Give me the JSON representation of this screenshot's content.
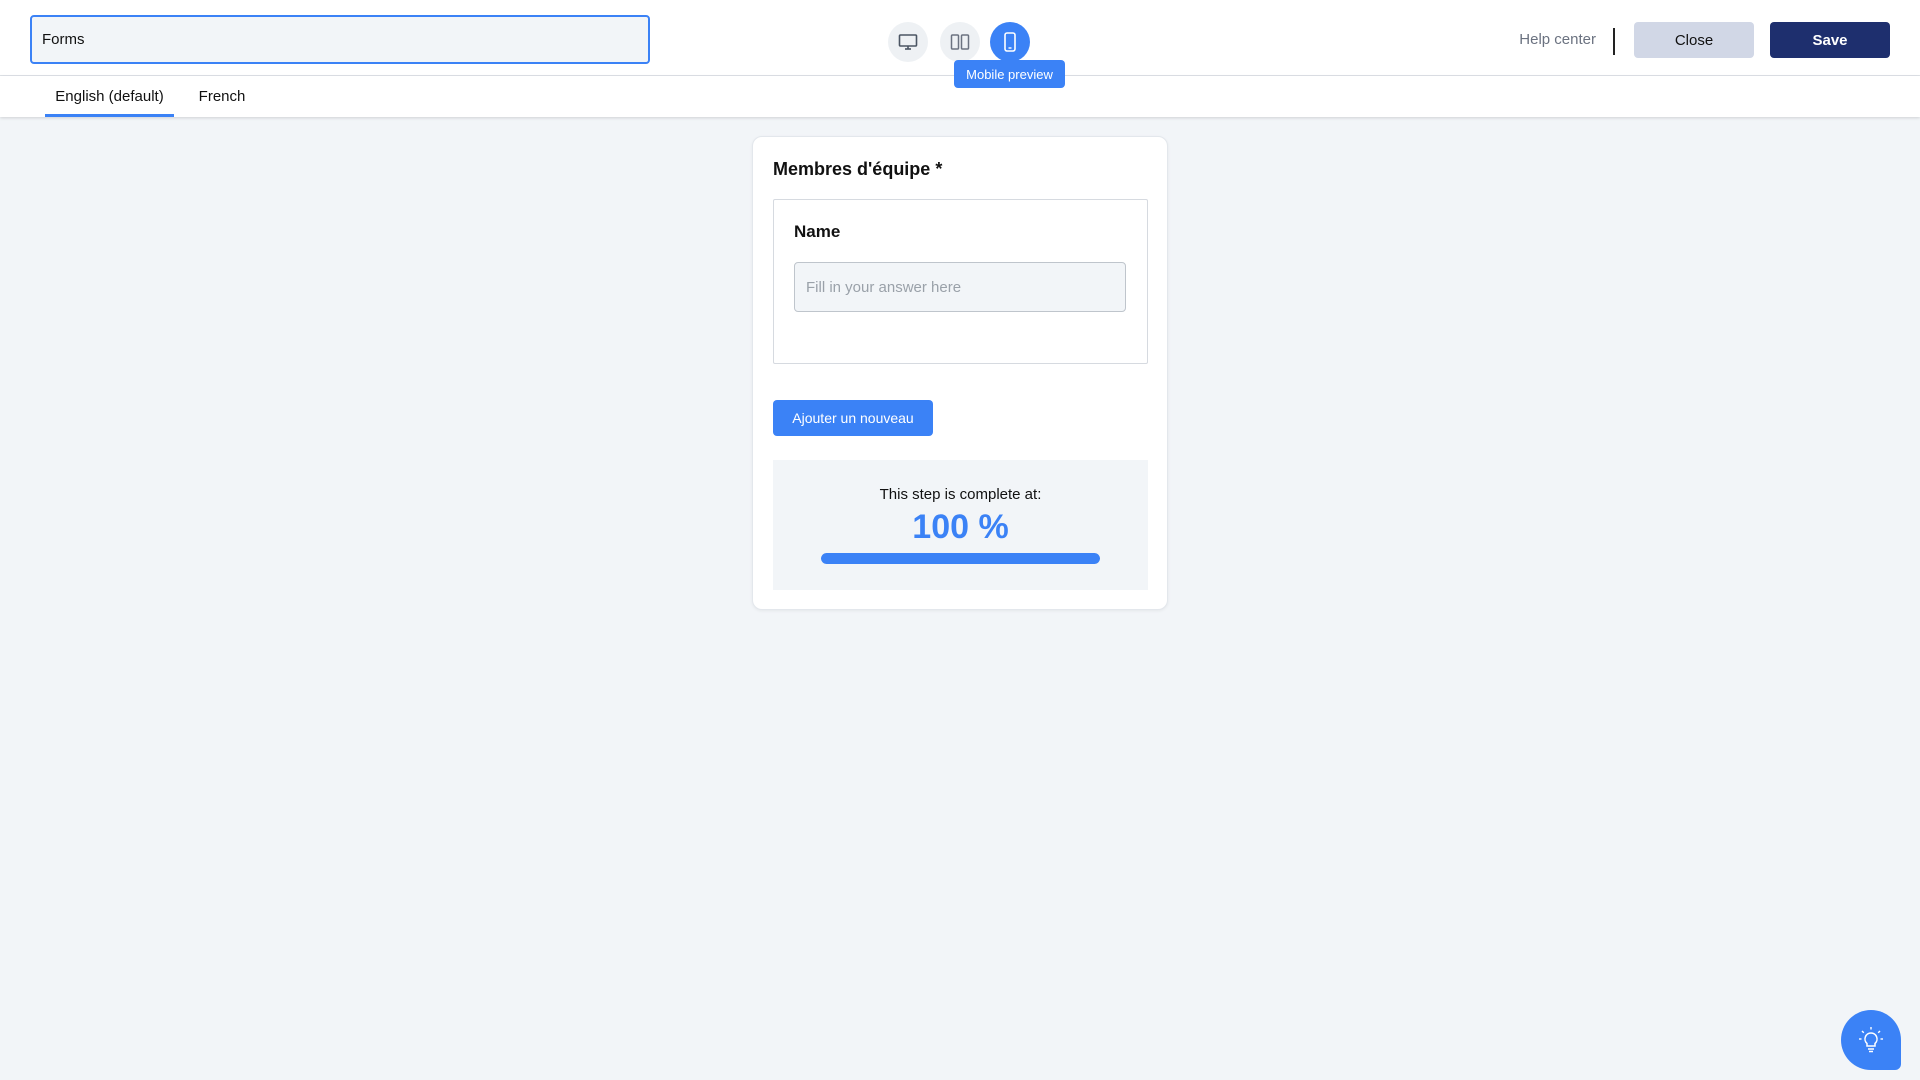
{
  "header": {
    "form_title_value": "Forms",
    "view_modes": [
      {
        "name": "desktop",
        "icon": "monitor-icon",
        "active": false
      },
      {
        "name": "split",
        "icon": "split-view-icon",
        "active": false
      },
      {
        "name": "mobile",
        "icon": "mobile-phone-icon",
        "active": true
      }
    ],
    "tooltip": "Mobile preview",
    "help_label": "Help center",
    "close_label": "Close",
    "save_label": "Save"
  },
  "language_tabs": [
    {
      "label": "English (default)",
      "active": true
    },
    {
      "label": "French",
      "active": false
    }
  ],
  "form": {
    "section_title": "Membres d'équipe *",
    "field": {
      "label": "Name",
      "placeholder": "Fill in your answer here"
    },
    "add_button_label": "Ajouter un nouveau",
    "progress": {
      "label": "This step is complete at:",
      "value_text": "100 %",
      "fraction": 1.0
    }
  },
  "floating_button": {
    "icon": "lightbulb-icon"
  },
  "colors": {
    "accent": "#3b82f6",
    "save_button": "#1e2f6e",
    "close_button": "#d1d7e6",
    "background": "#f2f5f8"
  }
}
